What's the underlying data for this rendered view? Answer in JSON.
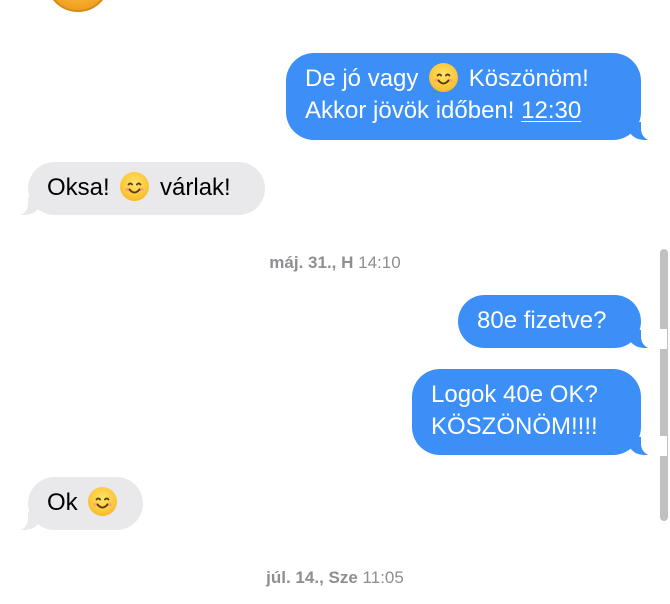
{
  "conversation": {
    "messages": [
      {
        "direction": "outgoing",
        "lines": [
          "De jó vagy",
          "Köszönöm!",
          "Akkor jövök időben!",
          "12:30"
        ]
      },
      {
        "direction": "incoming",
        "lines": [
          "Oksa!",
          "várlak!"
        ]
      },
      {
        "direction": "outgoing",
        "lines": [
          "80e fizetve?"
        ]
      },
      {
        "direction": "outgoing",
        "lines": [
          "Logok 40e OK?",
          "KÖSZÖNÖM!!!!"
        ]
      },
      {
        "direction": "incoming",
        "lines": [
          "Ok"
        ]
      }
    ],
    "timestamps": [
      {
        "date": "máj. 31., H",
        "time": "14:10"
      },
      {
        "date": "júl. 14., Sze",
        "time": "11:05"
      }
    ]
  },
  "icons": {
    "emoji": "smiling-face-emoji-icon",
    "avatar": "contact-avatar"
  },
  "colors": {
    "outgoing_bubble": "#3b8ff6",
    "incoming_bubble": "#e9e9eb",
    "timestamp_text": "#8e8e93"
  }
}
